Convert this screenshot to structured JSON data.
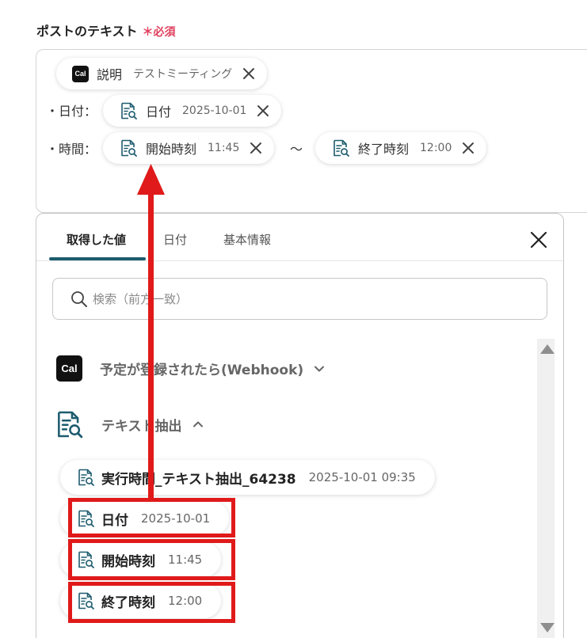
{
  "field": {
    "label": "ポストのテキスト",
    "required_mark": "＊必須"
  },
  "editor": {
    "chip_description": {
      "label": "説明",
      "value": "テストミーティング",
      "icon": "cal-logo"
    },
    "date_prefix": "・日付：",
    "chip_date": {
      "label": "日付",
      "value": "2025-10-01",
      "icon": "text-extract-icon"
    },
    "time_prefix": "・時間：",
    "chip_start": {
      "label": "開始時刻",
      "value": "11:45",
      "icon": "text-extract-icon"
    },
    "tilde": "〜",
    "chip_end": {
      "label": "終了時刻",
      "value": "12:00",
      "icon": "text-extract-icon"
    }
  },
  "panel": {
    "tabs": [
      {
        "label": "取得した値",
        "active": true
      },
      {
        "label": "日付",
        "active": false
      },
      {
        "label": "基本情報",
        "active": false
      }
    ],
    "search_placeholder": "検索（前方一致）",
    "sections": [
      {
        "label": "予定が登録されたら(Webhook)",
        "icon": "cal-logo",
        "expanded": false
      },
      {
        "label": "テキスト抽出",
        "icon": "text-extract-icon",
        "expanded": true
      }
    ],
    "items": [
      {
        "label": "実行時間_テキスト抽出_64238",
        "value": "2025-10-01 09:35"
      },
      {
        "label": "日付",
        "value": "2025-10-01"
      },
      {
        "label": "開始時刻",
        "value": "11:45"
      },
      {
        "label": "終了時刻",
        "value": "12:00"
      }
    ]
  },
  "colors": {
    "highlight": "#e01a1a",
    "accent": "#1d5b6e",
    "required": "#e0405e"
  },
  "cal_logo_text": "Cal"
}
